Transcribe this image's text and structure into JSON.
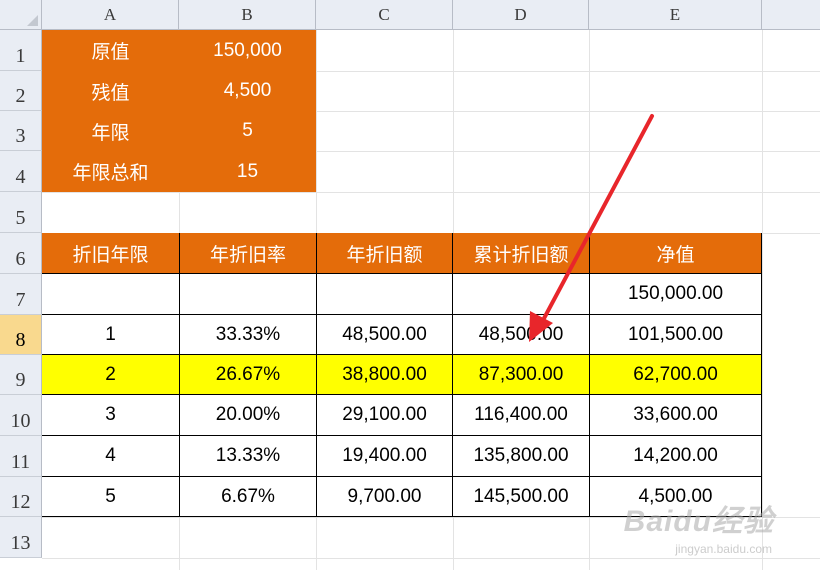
{
  "columns": [
    "A",
    "B",
    "C",
    "D",
    "E"
  ],
  "rows": [
    "1",
    "2",
    "3",
    "4",
    "5",
    "6",
    "7",
    "8",
    "9",
    "10",
    "11",
    "12",
    "13"
  ],
  "info": [
    {
      "label": "原值",
      "value": "150,000"
    },
    {
      "label": "残值",
      "value": "4,500"
    },
    {
      "label": "年限",
      "value": "5"
    },
    {
      "label": "年限总和",
      "value": "15"
    }
  ],
  "table": {
    "headers": [
      "折旧年限",
      "年折旧率",
      "年折旧额",
      "累计折旧额",
      "净值"
    ],
    "rows": [
      [
        "",
        "",
        "",
        "",
        "150,000.00"
      ],
      [
        "1",
        "33.33%",
        "48,500.00",
        "48,500.00",
        "101,500.00"
      ],
      [
        "2",
        "26.67%",
        "38,800.00",
        "87,300.00",
        "62,700.00"
      ],
      [
        "3",
        "20.00%",
        "29,100.00",
        "116,400.00",
        "33,600.00"
      ],
      [
        "4",
        "13.33%",
        "19,400.00",
        "135,800.00",
        "14,200.00"
      ],
      [
        "5",
        "6.67%",
        "9,700.00",
        "145,500.00",
        "4,500.00"
      ]
    ]
  },
  "selected_row": "8",
  "colors": {
    "header_orange": "#e46c0a",
    "highlight_yellow": "#ffff00",
    "arrow_red": "#e8262b"
  },
  "watermark": {
    "brand": "Baidu经验",
    "url": "jingyan.baidu.com"
  }
}
